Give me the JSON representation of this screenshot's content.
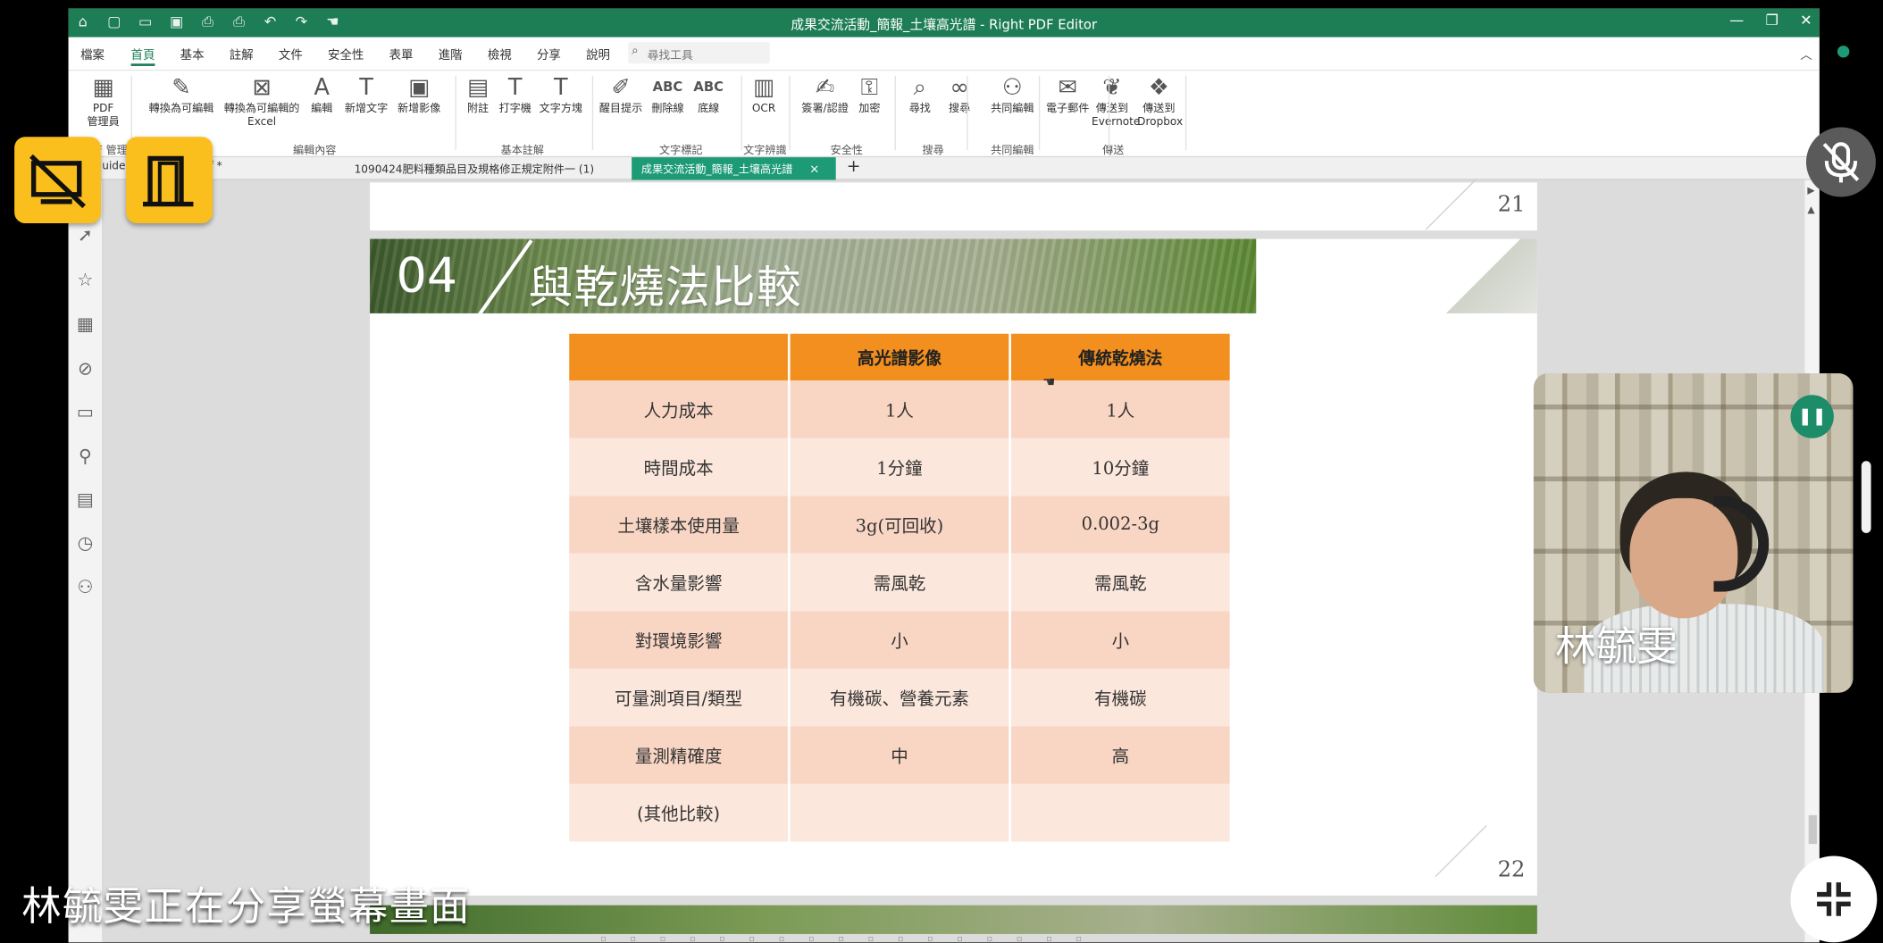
{
  "app": {
    "window_title": "成果交流活動_簡報_土壤高光譜 - Right PDF Editor",
    "menu": [
      "檔案",
      "首頁",
      "基本",
      "註解",
      "文件",
      "安全性",
      "表單",
      "進階",
      "檢視",
      "分享",
      "說明"
    ],
    "active_menu": "首頁",
    "search_placeholder": "尋找工具",
    "ribbon_buttons": [
      {
        "label": "PDF\n管理員",
        "icon": "pdf-manager-icon",
        "glyph": "▦"
      },
      {
        "label": "轉換為可編輯",
        "icon": "convert-editable-icon",
        "glyph": "✎"
      },
      {
        "label": "轉換為可編輯的\nExcel",
        "icon": "convert-excel-icon",
        "glyph": "⊠"
      },
      {
        "label": "編輯",
        "icon": "edit-text-icon",
        "glyph": "A"
      },
      {
        "label": "新增文字",
        "icon": "add-text-icon",
        "glyph": "T"
      },
      {
        "label": "新增影像",
        "icon": "add-image-icon",
        "glyph": "▣"
      },
      {
        "label": "附註",
        "icon": "note-icon",
        "glyph": "▤"
      },
      {
        "label": "打字機",
        "icon": "typewriter-icon",
        "glyph": "T"
      },
      {
        "label": "文字方塊",
        "icon": "textbox-icon",
        "glyph": "T"
      },
      {
        "label": "醒目提示",
        "icon": "highlight-icon",
        "glyph": "✐"
      },
      {
        "label": "刪除線",
        "icon": "strikethrough-icon",
        "glyph": "ABC"
      },
      {
        "label": "底線",
        "icon": "underline-icon",
        "glyph": "ABC"
      },
      {
        "label": "OCR",
        "icon": "ocr-icon",
        "glyph": "▥"
      },
      {
        "label": "簽署/認證",
        "icon": "sign-icon",
        "glyph": "✍"
      },
      {
        "label": "加密",
        "icon": "lock-icon",
        "glyph": "⚿"
      },
      {
        "label": "尋找",
        "icon": "search-icon",
        "glyph": "⌕"
      },
      {
        "label": "搜尋",
        "icon": "binoculars-icon",
        "glyph": "∞"
      },
      {
        "label": "共同編輯",
        "icon": "coedit-icon",
        "glyph": "⚇"
      },
      {
        "label": "電子郵件",
        "icon": "email-icon",
        "glyph": "✉"
      },
      {
        "label": "傳送到\nEvernote",
        "icon": "evernote-icon",
        "glyph": "❦"
      },
      {
        "label": "傳送到\nDropbox",
        "icon": "dropbox-icon",
        "glyph": "❖"
      }
    ],
    "ribbon_groups": [
      "PDF 管理員",
      "編輯內容",
      "基本註解",
      "文字標記",
      "文字辨識",
      "安全性",
      "搜尋",
      "共同編輯",
      "傳送"
    ],
    "tabs": [
      {
        "label": "uide... of biochar.pdf *",
        "active": false
      },
      {
        "label": "1090424肥料種類品目及規格修正規定附件一 (1)",
        "active": false
      },
      {
        "label": "成果交流活動_簡報_土壤高光譜",
        "active": true
      }
    ],
    "tab_close": "×",
    "tab_add": "+"
  },
  "slides": {
    "prev_page_number": "21",
    "page_number": "22",
    "section_number": "04",
    "heading": "與乾燒法比較",
    "table": {
      "headers": [
        "",
        "高光譜影像",
        "傳統乾燒法"
      ],
      "rows": [
        [
          "人力成本",
          "1人",
          "1人"
        ],
        [
          "時間成本",
          "1分鐘",
          "10分鐘"
        ],
        [
          "土壤樣本使用量",
          "3g(可回收)",
          "0.002-3g"
        ],
        [
          "含水量影響",
          "需風乾",
          "需風乾"
        ],
        [
          "對環境影響",
          "小",
          "小"
        ],
        [
          "可量測項目/類型",
          "有機碳、營養元素",
          "有機碳"
        ],
        [
          "量測精確度",
          "中",
          "高"
        ],
        [
          "(其他比較)",
          "",
          ""
        ]
      ]
    }
  },
  "meeting": {
    "participant_name": "林毓雯",
    "share_caption": "林毓雯正在分享螢幕畫面",
    "accent_color": "#fbbf1d",
    "speaking_color": "#1d8c69"
  }
}
